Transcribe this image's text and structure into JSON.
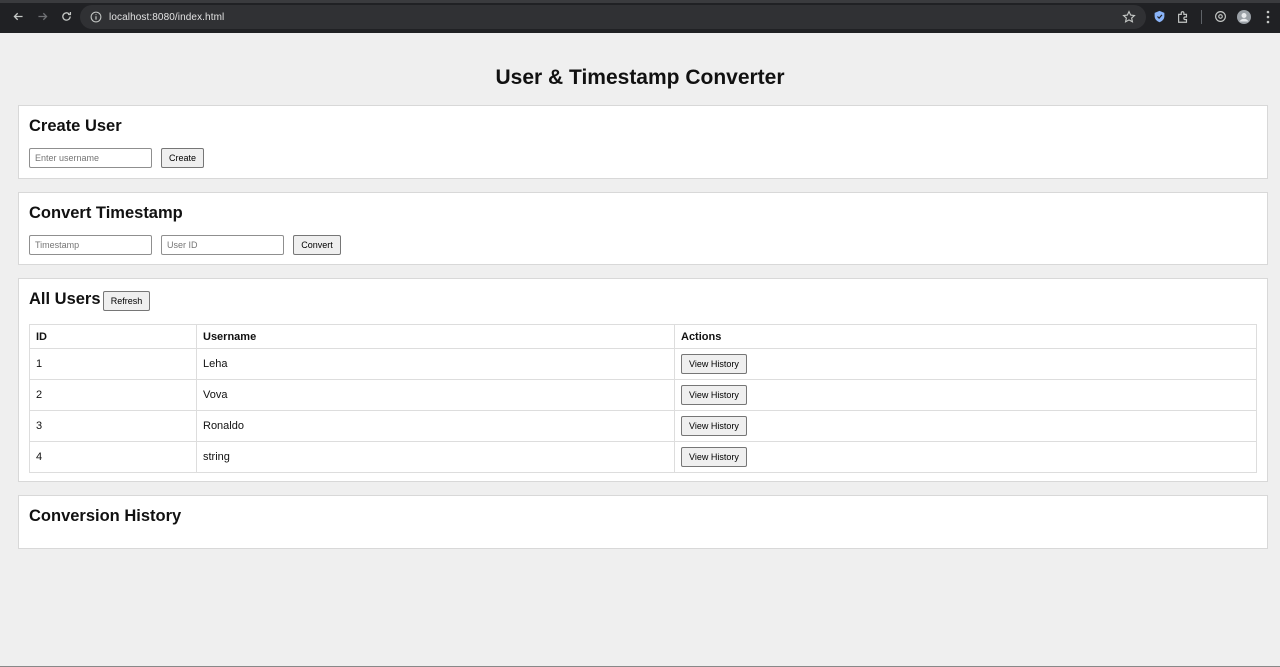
{
  "browser": {
    "url": "localhost:8080/index.html"
  },
  "page": {
    "title": "User & Timestamp Converter"
  },
  "create_user": {
    "heading": "Create User",
    "username_placeholder": "Enter username",
    "create_label": "Create"
  },
  "convert_timestamp": {
    "heading": "Convert Timestamp",
    "timestamp_placeholder": "Timestamp",
    "userid_placeholder": "User ID",
    "convert_label": "Convert"
  },
  "all_users": {
    "heading": "All Users",
    "refresh_label": "Refresh",
    "columns": [
      "ID",
      "Username",
      "Actions"
    ],
    "rows": [
      {
        "id": "1",
        "username": "Leha",
        "action": "View History"
      },
      {
        "id": "2",
        "username": "Vova",
        "action": "View History"
      },
      {
        "id": "3",
        "username": "Ronaldo",
        "action": "View History"
      },
      {
        "id": "4",
        "username": "string",
        "action": "View History"
      }
    ]
  },
  "conversion_history": {
    "heading": "Conversion History"
  }
}
